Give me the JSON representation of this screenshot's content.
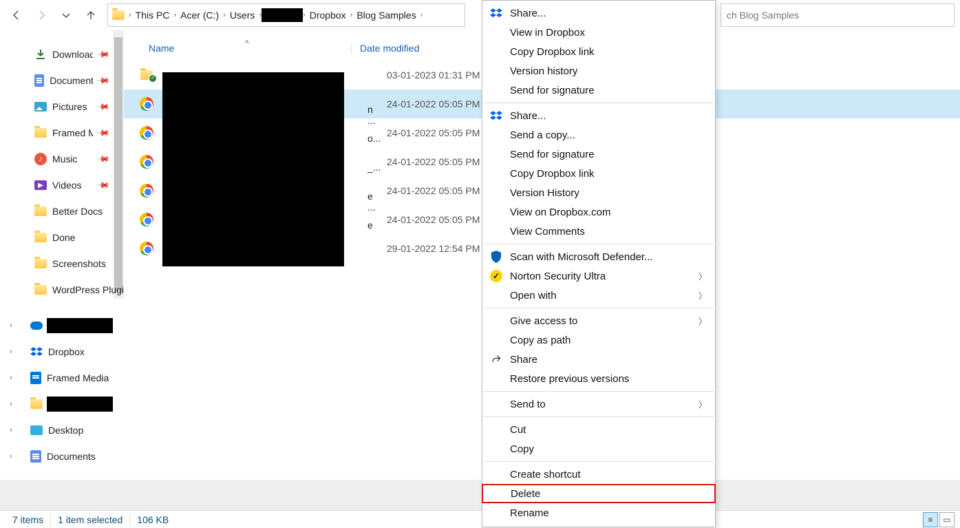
{
  "nav": {
    "breadcrumb": [
      "This PC",
      "Acer (C:)",
      "Users",
      "[REDACTED]",
      "Dropbox",
      "Blog Samples"
    ],
    "search_placeholder": "ch Blog Samples"
  },
  "sidebar": {
    "quick": [
      {
        "label": "Downloads",
        "icon": "download",
        "pinned": true
      },
      {
        "label": "Documents",
        "icon": "doc",
        "pinned": true
      },
      {
        "label": "Pictures",
        "icon": "pic",
        "pinned": true
      },
      {
        "label": "Framed Media",
        "icon": "folder",
        "pinned": true
      },
      {
        "label": "Music",
        "icon": "music",
        "pinned": true
      },
      {
        "label": "Videos",
        "icon": "video",
        "pinned": true
      },
      {
        "label": "Better Docs",
        "icon": "folder",
        "pinned": false
      },
      {
        "label": "Done",
        "icon": "folder",
        "pinned": false
      },
      {
        "label": "Screenshots",
        "icon": "folder",
        "pinned": false
      },
      {
        "label": "WordPress Plugins",
        "icon": "folder",
        "pinned": false
      }
    ],
    "tree": [
      {
        "label": "",
        "icon": "cloud",
        "redacted": true
      },
      {
        "label": "Dropbox",
        "icon": "dropbox"
      },
      {
        "label": "Framed Media",
        "icon": "bluedoc"
      },
      {
        "label": "",
        "icon": "folder",
        "redacted": true
      },
      {
        "label": "Desktop",
        "icon": "monitor"
      },
      {
        "label": "Documents",
        "icon": "doc"
      }
    ]
  },
  "columns": {
    "name": "Name",
    "date": "Date modified"
  },
  "files": [
    {
      "icon": "folder-sync",
      "date": "03-01-2023 01:31 PM",
      "trunc": ""
    },
    {
      "icon": "chrome",
      "selected": true,
      "date": "24-01-2022 05:05 PM",
      "trunc": "n ..."
    },
    {
      "icon": "chrome",
      "date": "24-01-2022 05:05 PM",
      "trunc": "o..."
    },
    {
      "icon": "chrome",
      "date": "24-01-2022 05:05 PM",
      "trunc": "_..."
    },
    {
      "icon": "chrome",
      "date": "24-01-2022 05:05 PM",
      "trunc": "e ..."
    },
    {
      "icon": "chrome",
      "date": "24-01-2022 05:05 PM",
      "trunc": "e"
    },
    {
      "icon": "chrome",
      "date": "29-01-2022 12:54 PM",
      "trunc": ""
    }
  ],
  "context_menu": {
    "groups": [
      [
        {
          "label": "Share...",
          "icon": "dropbox"
        },
        {
          "label": "View in Dropbox"
        },
        {
          "label": "Copy Dropbox link"
        },
        {
          "label": "Version history"
        },
        {
          "label": "Send for signature"
        }
      ],
      [
        {
          "label": "Share...",
          "icon": "dropbox"
        },
        {
          "label": "Send a copy..."
        },
        {
          "label": "Send for signature"
        },
        {
          "label": "Copy Dropbox link"
        },
        {
          "label": "Version History"
        },
        {
          "label": "View on Dropbox.com"
        },
        {
          "label": "View Comments"
        }
      ],
      [
        {
          "label": "Scan with Microsoft Defender...",
          "icon": "shield"
        },
        {
          "label": "Norton Security Ultra",
          "icon": "norton",
          "submenu": true
        },
        {
          "label": "Open with",
          "submenu": true
        }
      ],
      [
        {
          "label": "Give access to",
          "submenu": true
        },
        {
          "label": "Copy as path"
        },
        {
          "label": "Share",
          "icon": "share"
        },
        {
          "label": "Restore previous versions"
        }
      ],
      [
        {
          "label": "Send to",
          "submenu": true
        }
      ],
      [
        {
          "label": "Cut"
        },
        {
          "label": "Copy"
        }
      ],
      [
        {
          "label": "Create shortcut"
        },
        {
          "label": "Delete",
          "highlight": true
        },
        {
          "label": "Rename"
        }
      ]
    ]
  },
  "status": {
    "items": "7 items",
    "selected": "1 item selected",
    "size": "106 KB"
  }
}
